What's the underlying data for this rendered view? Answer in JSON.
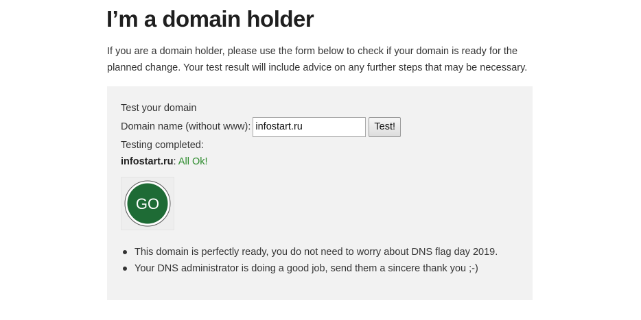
{
  "header": {
    "title": "I’m a domain holder"
  },
  "intro": {
    "text": "If you are a domain holder, please use the form below to check if your domain is ready for the planned change. Your test result will include advice on any further steps that may be necessary."
  },
  "test_panel": {
    "heading": "Test your domain",
    "domain_label": "Domain name (without www):",
    "domain_value": "infostart.ru",
    "test_button_label": "Test!",
    "status_text": "Testing completed:",
    "result_domain": "infostart.ru",
    "result_separator": ":",
    "result_status": "All Ok!",
    "badge_text": "GO",
    "badge_color": "#1e6b35",
    "ok_color": "#2a8a2a",
    "advice": [
      "This domain is perfectly ready, you do not need to worry about DNS flag day 2019.",
      "Your DNS administrator is doing a good job, send them a sincere thank you ;-)"
    ]
  }
}
